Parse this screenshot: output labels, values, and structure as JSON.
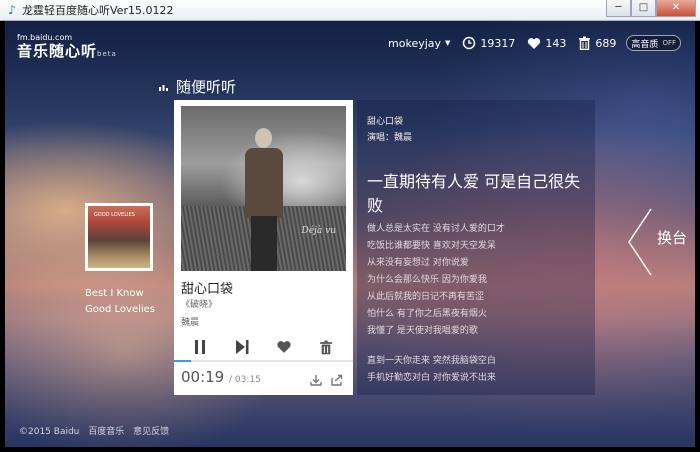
{
  "window": {
    "title": "龙霆轻百度随心听Ver15.0122",
    "minimize": "─",
    "maximize": "□",
    "close": "✕"
  },
  "logo": {
    "domain": "fm.baidu.com",
    "name": "音乐随心听",
    "tag": "beta"
  },
  "header": {
    "username": "mokeyjay",
    "listened_count": "19317",
    "liked_count": "143",
    "trash_count": "689",
    "quality_label": "高音质",
    "quality_state": "OFF",
    "icons": [
      "history-icon",
      "heart-icon",
      "trash-icon",
      "dropdown-arrow-icon"
    ]
  },
  "channel": {
    "name": "随便听听",
    "icon": "bars-icon"
  },
  "previous_song": {
    "line1": "Best I Know",
    "line2": "Good Lovelies",
    "cover_text": "GOOD LOVELIES"
  },
  "player": {
    "title": "甜心口袋",
    "album": "《破晓》",
    "artist": "魏晨",
    "elapsed": "00:19",
    "total": "/ 03:15",
    "progress_fraction": 0.097,
    "cover_signature": "Déjà vu",
    "controls": [
      "pause-icon",
      "next-icon",
      "heart-icon",
      "trash-icon"
    ],
    "extra": [
      "download-icon",
      "share-icon"
    ],
    "accent_color": "#2e9df5"
  },
  "lyrics": {
    "song": "甜心口袋",
    "singer": "演唱：魏晨",
    "current_line": "一直期待有人爱 可是自己很失败",
    "lines": [
      "做人总是太实在 没有讨人爱的口才",
      "吃饭比谁都要快 喜欢对天空发呆",
      "从来没有妄想过 对你说爱",
      "为什么会那么快乐 因为你爱我",
      "从此后就我的日记不再有苦涩",
      "怕什么 有了你之后黑夜有烟火",
      "我懂了 是天使对我唱爱的歌"
    ],
    "lines_after": [
      "直到一天你走来 突然我脑袋空白",
      "手机好勤恋对白 对你爱说不出来"
    ]
  },
  "next_button": {
    "label": "换台"
  },
  "footer": {
    "copyright": "©2015 Baidu",
    "link1": "百度音乐",
    "link2": "意见反馈"
  }
}
